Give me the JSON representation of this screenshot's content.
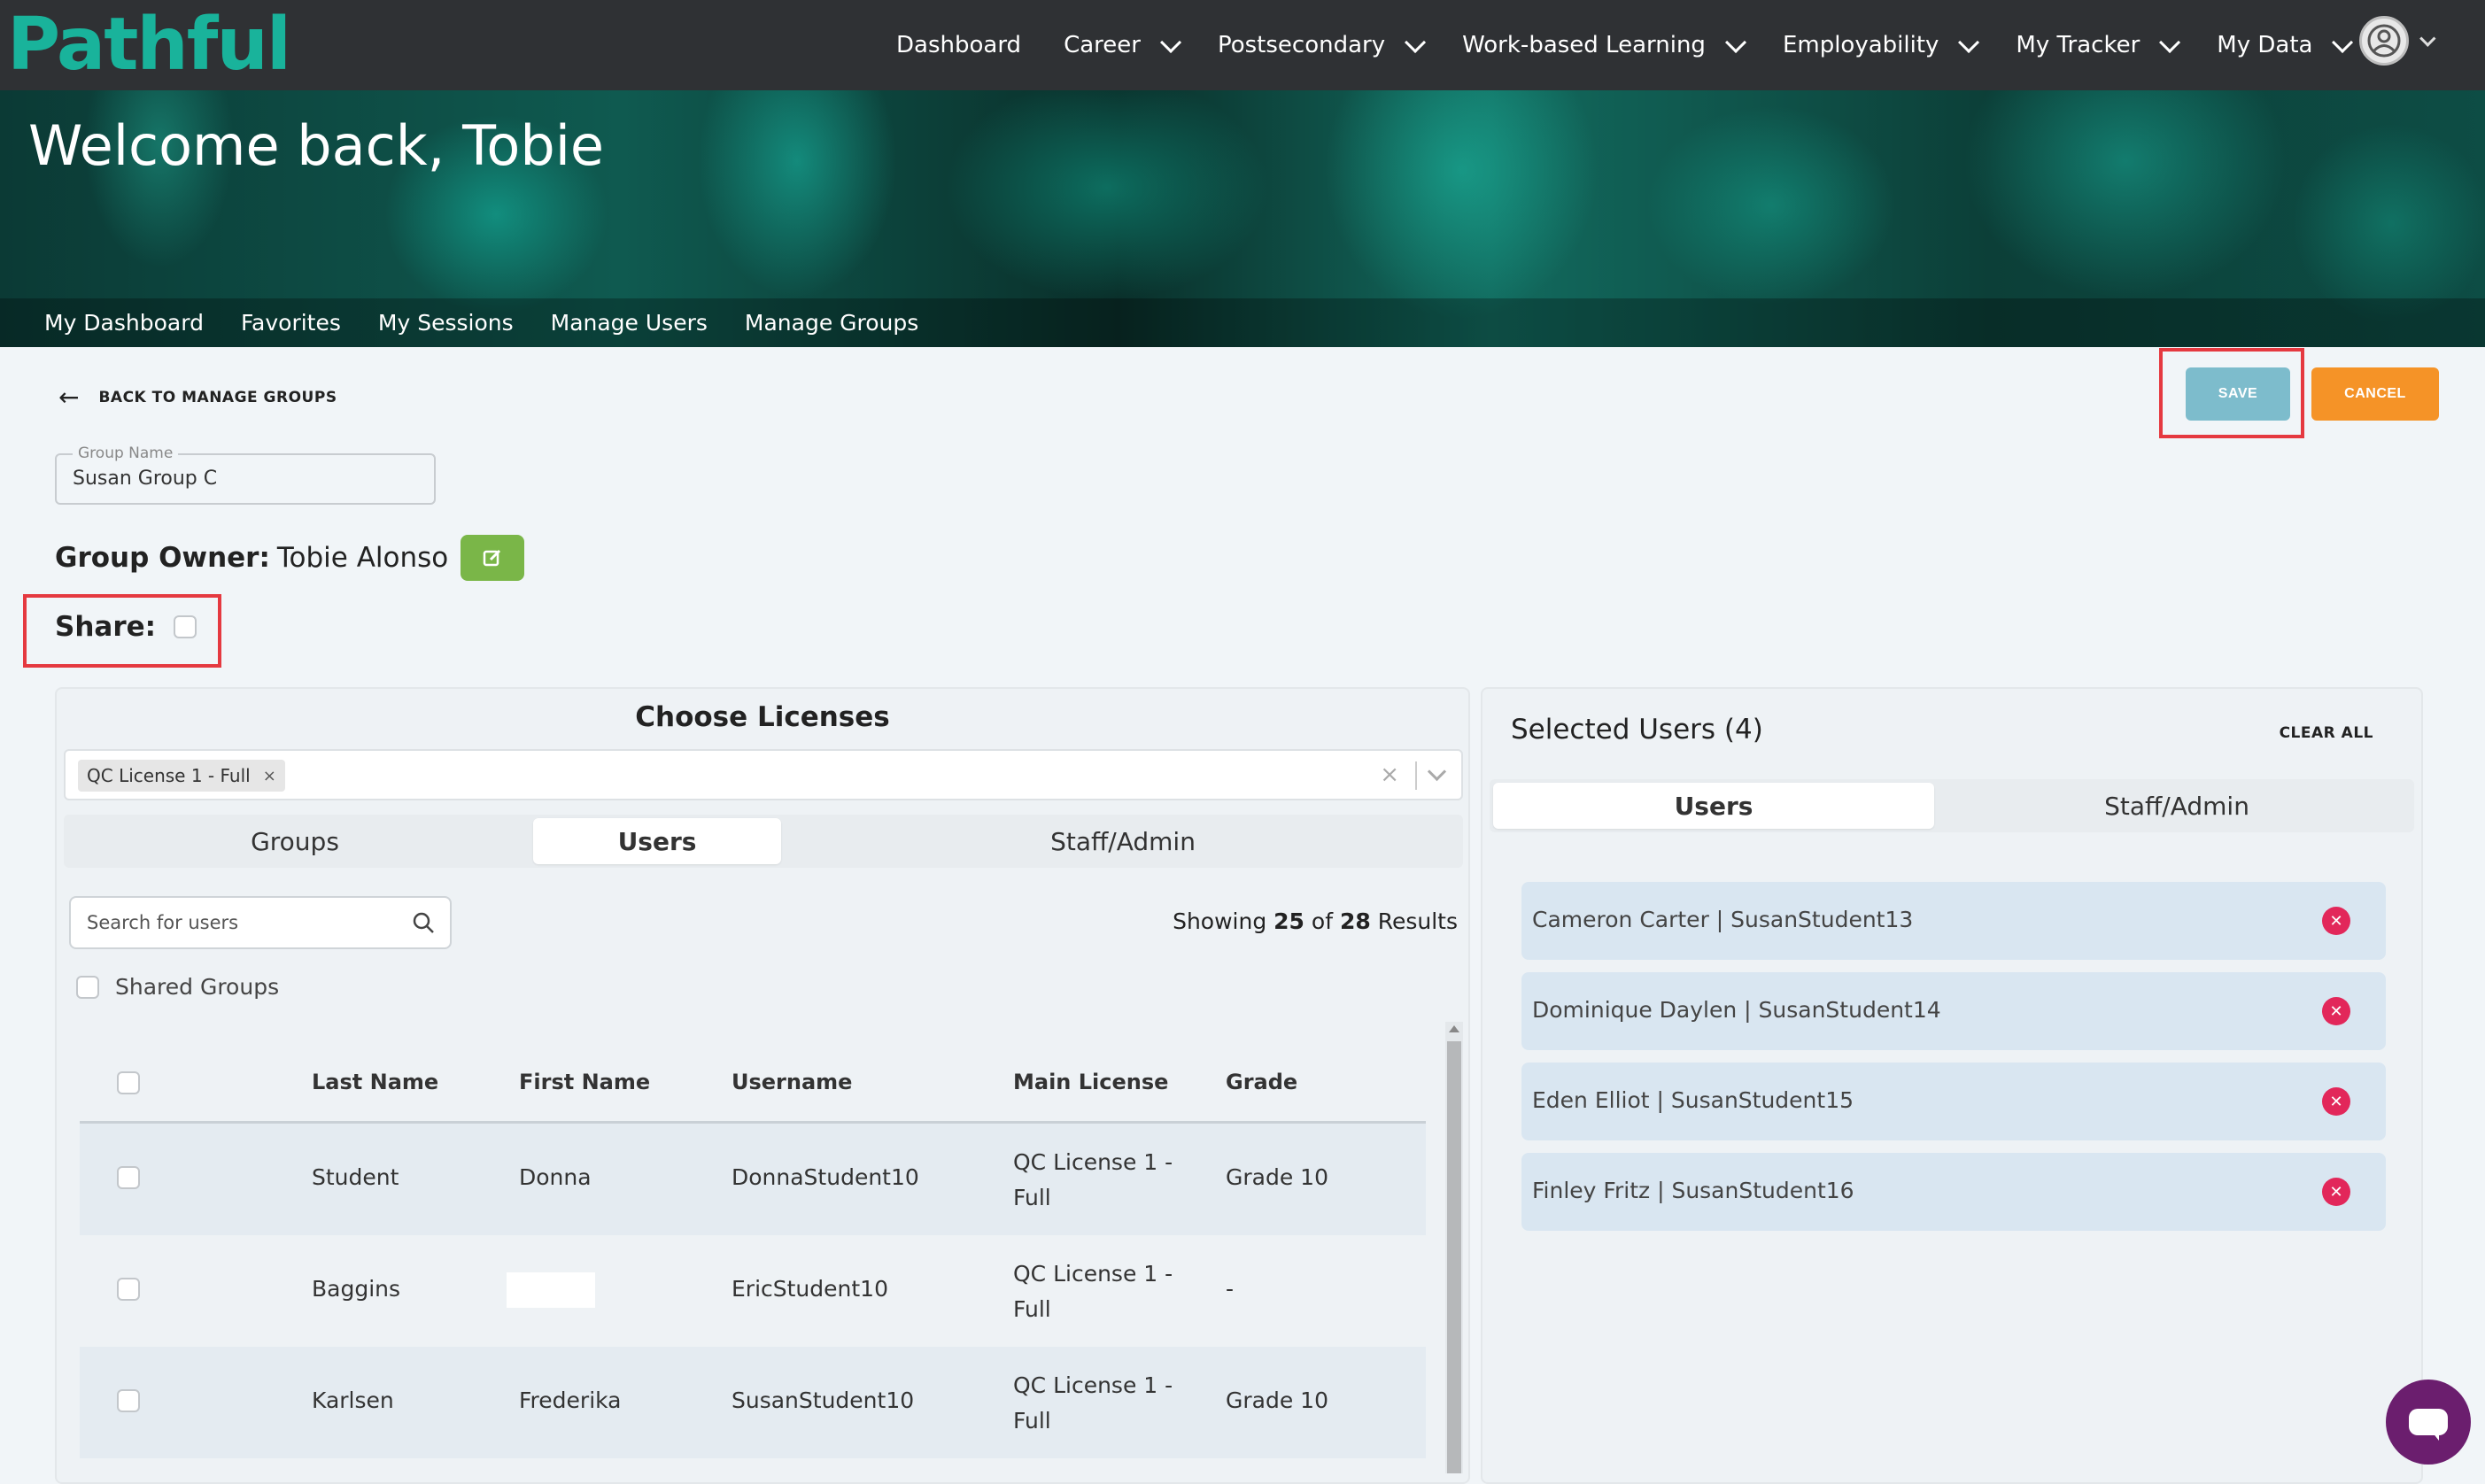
{
  "brand": {
    "logo_text": "Pathful",
    "accent": "#19b39b"
  },
  "nav": {
    "items": [
      {
        "label": "Dashboard",
        "dropdown": false
      },
      {
        "label": "Career",
        "dropdown": true
      },
      {
        "label": "Postsecondary",
        "dropdown": true
      },
      {
        "label": "Work-based Learning",
        "dropdown": true
      },
      {
        "label": "Employability",
        "dropdown": true
      },
      {
        "label": "My Tracker",
        "dropdown": true
      },
      {
        "label": "My Data",
        "dropdown": true
      }
    ],
    "avatar_icon": "user-circle-icon"
  },
  "hero": {
    "title": "Welcome back, Tobie"
  },
  "subnav": [
    "My Dashboard",
    "Favorites",
    "My Sessions",
    "Manage Users",
    "Manage Groups"
  ],
  "page": {
    "back_label": "BACK TO MANAGE GROUPS",
    "save_label": "SAVE",
    "cancel_label": "CANCEL",
    "save_color": "#7dbccc",
    "cancel_color": "#f59327",
    "group_name_label": "Group Name",
    "group_name_value": "Susan Group C",
    "owner_label": "Group Owner:",
    "owner_value": "Tobie Alonso",
    "share_label": "Share:",
    "share_checked": false
  },
  "licenses": {
    "title": "Choose Licenses",
    "selected_chip": "QC License 1 - Full",
    "tabs": [
      "Groups",
      "Users",
      "Staff/Admin"
    ],
    "active_tab": "Users",
    "search_placeholder": "Search for users",
    "results_prefix": "Showing",
    "results_shown": "25",
    "results_of": "of",
    "results_total": "28",
    "results_suffix": "Results",
    "shared_groups_label": "Shared Groups",
    "columns": [
      "Last Name",
      "First Name",
      "Username",
      "Main License",
      "Grade"
    ],
    "rows": [
      {
        "last": "Student",
        "first": "Donna",
        "username": "DonnaStudent10",
        "license_l1": "QC License 1 -",
        "license_l2": "Full",
        "grade": "Grade 10"
      },
      {
        "last": "Baggins",
        "first": "",
        "username": "EricStudent10",
        "license_l1": "QC License 1 -",
        "license_l2": "Full",
        "grade": "-"
      },
      {
        "last": "Karlsen",
        "first": "Frederika",
        "username": "SusanStudent10",
        "license_l1": "QC License 1 -",
        "license_l2": "Full",
        "grade": "Grade 10"
      }
    ]
  },
  "selected": {
    "title": "Selected Users (4)",
    "clear_all": "CLEAR ALL",
    "tabs": [
      "Users",
      "Staff/Admin"
    ],
    "active_tab": "Users",
    "users": [
      "Cameron Carter | SusanStudent13",
      "Dominique Daylen | SusanStudent14",
      "Eden Elliot | SusanStudent15",
      "Finley Fritz | SusanStudent16"
    ]
  },
  "highlight_color": "#e53940",
  "chat": {
    "icon": "chat-bubble-icon",
    "color": "#6b1e6e"
  }
}
